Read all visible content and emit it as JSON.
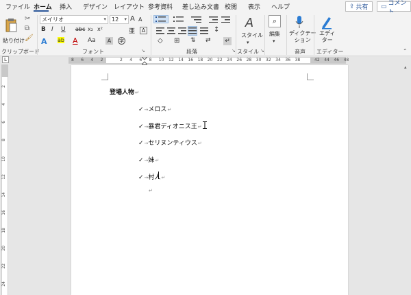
{
  "tabs": [
    "ファイル",
    "ホーム",
    "挿入",
    "デザイン",
    "レイアウト",
    "参考資料",
    "差し込み文書",
    "校閲",
    "表示",
    "ヘルプ"
  ],
  "share": "共有",
  "comment": "コメント",
  "clipboard": {
    "paste": "貼り付け",
    "label": "クリップボード"
  },
  "font": {
    "name": "メイリオ",
    "size": "12",
    "label": "フォント",
    "grow": "A",
    "shrink": "A",
    "case": "Aa",
    "clear": "A",
    "bold": "B",
    "italic": "I",
    "underline": "U",
    "strike": "abc",
    "sub": "x₂",
    "sup": "x²",
    "effects": "A",
    "highlight": "ab",
    "color": "A",
    "phonetic": "亜",
    "enclose": "字"
  },
  "paragraph": {
    "label": "段落"
  },
  "styles": {
    "button": "スタイル",
    "label": "スタイル"
  },
  "editing": {
    "button": "編集"
  },
  "voice": {
    "button": "ディクテー\nション",
    "label": "音声"
  },
  "editor": {
    "button": "エディ\nター",
    "label": "エディター"
  },
  "hruler": [
    "8",
    "6",
    "4",
    "2",
    "",
    "2",
    "4",
    "6",
    "8",
    "10",
    "12",
    "14",
    "16",
    "18",
    "20",
    "22",
    "24",
    "26",
    "28",
    "30",
    "32",
    "34",
    "36",
    "38",
    "",
    "42",
    "44",
    "46",
    "48"
  ],
  "vruler": [
    "2",
    "4",
    "6",
    "8",
    "10",
    "12",
    "14",
    "16",
    "18",
    "20",
    "22",
    "24"
  ],
  "document": {
    "heading": "登場人物",
    "items": [
      "メロス",
      "暴君ディオニス王",
      "セリヌンティウス",
      "妹",
      "村人"
    ],
    "bullet": "✓",
    "arrow": "→",
    "para_mark": "↵"
  }
}
